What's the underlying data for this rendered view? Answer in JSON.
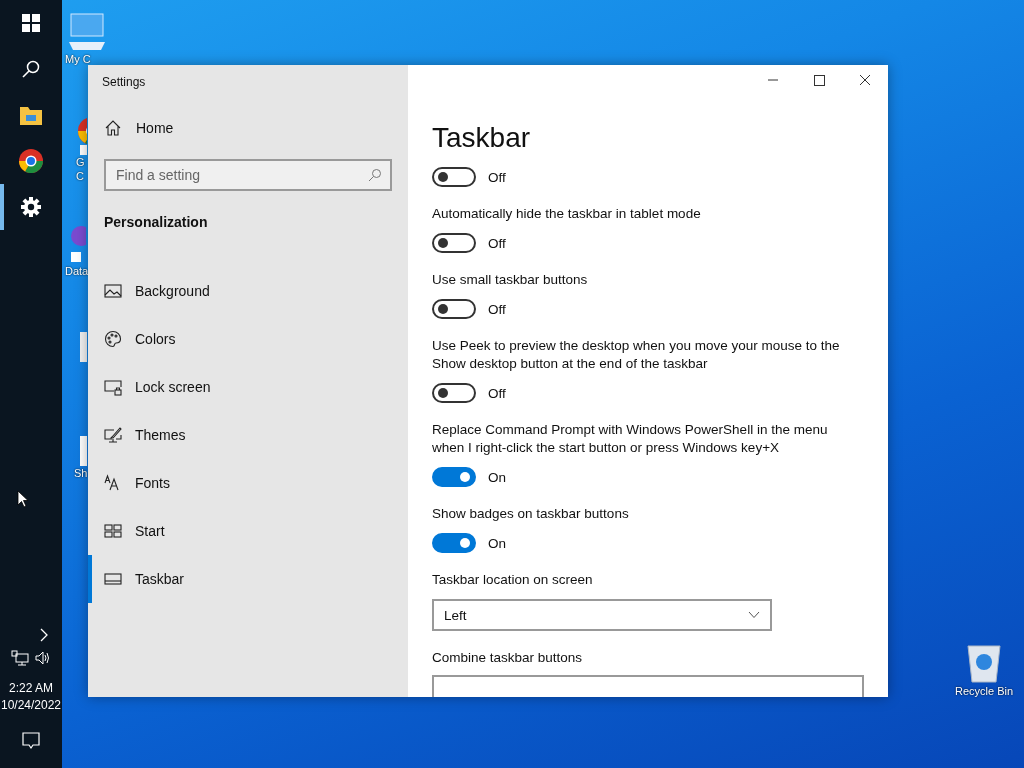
{
  "taskbar": {
    "apps": [
      {
        "kind": "explorer",
        "selected": false
      },
      {
        "kind": "chrome",
        "selected": false
      },
      {
        "kind": "settings",
        "selected": true
      }
    ],
    "time": "2:22 AM",
    "date": "10/24/2022"
  },
  "desktop_icons": [
    {
      "kind": "computer",
      "lines": [
        "My C"
      ]
    },
    {
      "kind": "chrome",
      "lines": [
        "G",
        "C"
      ]
    },
    {
      "kind": "shortcut",
      "lines": [
        "Data"
      ]
    },
    {
      "kind": "file"
    },
    {
      "kind": "note",
      "lines": [
        "Sh"
      ]
    },
    {
      "kind": "recycle",
      "lines": [
        "Recycle Bin"
      ]
    }
  ],
  "window": {
    "title": "Settings"
  },
  "sidebar": {
    "home": "Home",
    "search": {
      "placeholder": "Find a setting"
    },
    "section": "Personalization",
    "items": [
      {
        "kind": "background",
        "label": "Background",
        "selected": false
      },
      {
        "kind": "colors",
        "label": "Colors",
        "selected": false
      },
      {
        "kind": "lock",
        "label": "Lock screen",
        "selected": false
      },
      {
        "kind": "themes",
        "label": "Themes",
        "selected": false
      },
      {
        "kind": "fonts",
        "label": "Fonts",
        "selected": false
      },
      {
        "kind": "start",
        "label": "Start",
        "selected": false
      },
      {
        "kind": "taskbar",
        "label": "Taskbar",
        "selected": true
      }
    ]
  },
  "page": {
    "title": "Taskbar",
    "settings": [
      {
        "kind": "toggle",
        "on": false,
        "state": "Off"
      },
      {
        "kind": "toggle",
        "label": "Automatically hide the taskbar in tablet mode",
        "on": false,
        "state": "Off"
      },
      {
        "kind": "toggle",
        "label": "Use small taskbar buttons",
        "on": false,
        "state": "Off"
      },
      {
        "kind": "toggle",
        "label": "Use Peek to preview the desktop when you move your mouse to the Show desktop button at the end of the taskbar",
        "on": false,
        "state": "Off"
      },
      {
        "kind": "toggle",
        "label": "Replace Command Prompt with Windows PowerShell in the menu when I right-click the start button or press Windows key+X",
        "on": true,
        "state": "On"
      },
      {
        "kind": "toggle",
        "label": "Show badges on taskbar buttons",
        "on": true,
        "state": "On"
      },
      {
        "kind": "dropdown",
        "label": "Taskbar location on screen",
        "value": "Left"
      },
      {
        "kind": "dropdown_cut",
        "label": "Combine taskbar buttons"
      }
    ]
  }
}
